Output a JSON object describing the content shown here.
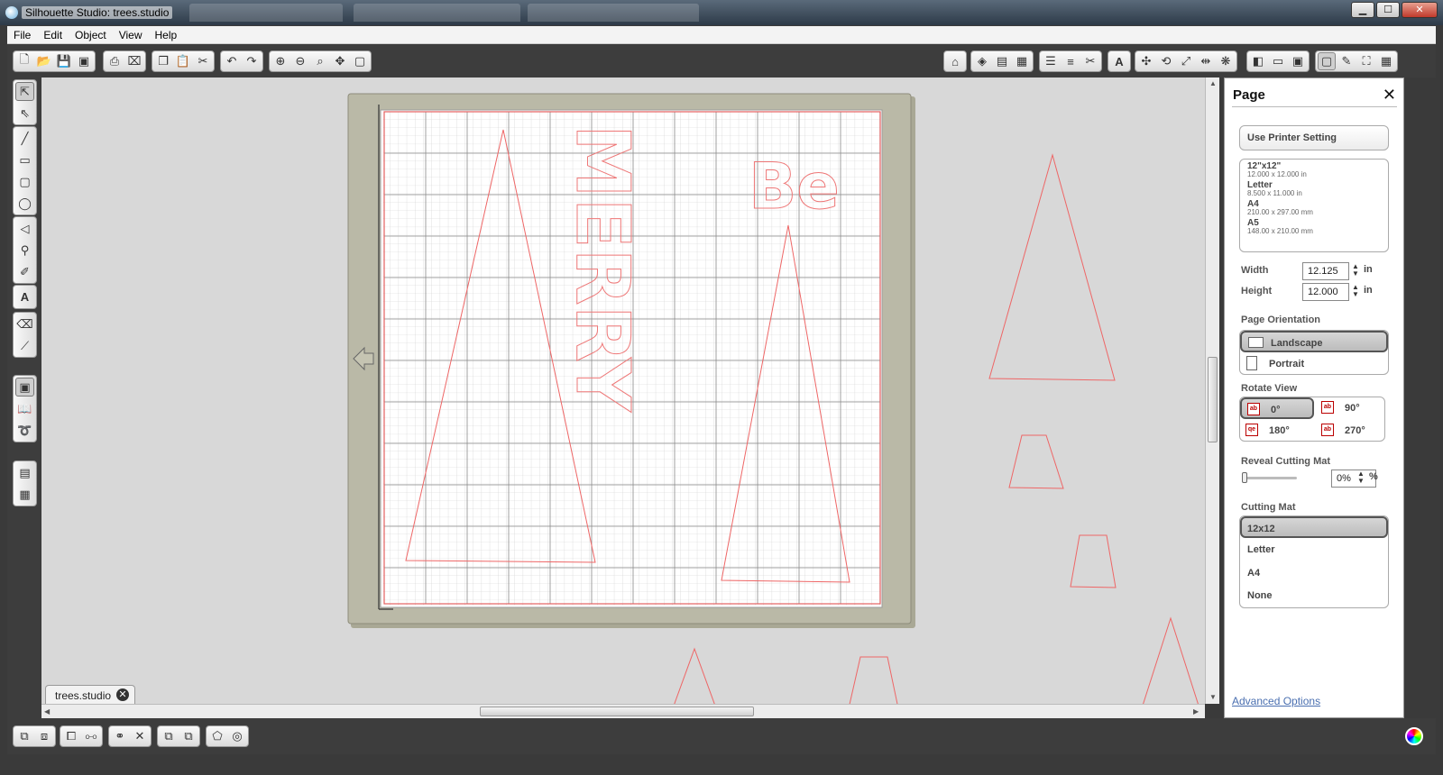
{
  "window": {
    "title": "Silhouette Studio: trees.studio",
    "controls": {
      "minimize": "▁",
      "maximize": "☐",
      "close": "✕"
    }
  },
  "menu": [
    "File",
    "Edit",
    "Object",
    "View",
    "Help"
  ],
  "canvas": {
    "text_merry": "MERRY",
    "text_be": "Be"
  },
  "doc_tab": {
    "label": "trees.studio",
    "close": "✕"
  },
  "panel": {
    "title": "Page",
    "close": "✕",
    "use_printer_setting": "Use Printer Setting",
    "sizes": [
      {
        "name": "12\"x12\"",
        "dims": "12.000 x 12.000 in"
      },
      {
        "name": "Letter",
        "dims": "8.500 x 11.000 in"
      },
      {
        "name": "A4",
        "dims": "210.00 x 297.00 mm"
      },
      {
        "name": "A5",
        "dims": "148.00 x 210.00 mm"
      }
    ],
    "width_label": "Width",
    "width_value": "12.125",
    "height_label": "Height",
    "height_value": "12.000",
    "unit": "in",
    "orientation_label": "Page Orientation",
    "orientation_landscape": "Landscape",
    "orientation_portrait": "Portrait",
    "rotate_label": "Rotate View",
    "rotate_0": "0°",
    "rotate_90": "90°",
    "rotate_180": "180°",
    "rotate_270": "270°",
    "reveal_label": "Reveal Cutting Mat",
    "reveal_value": "0%",
    "reveal_unit": "%",
    "reveal_level": 0,
    "cutting_mat_label": "Cutting Mat",
    "mats": [
      "12x12",
      "Letter",
      "A4",
      "None"
    ],
    "advanced": "Advanced Options"
  },
  "colors": {
    "cut_line": "#ee6666",
    "mat_gray": "#b9b8a6",
    "workspace": "#d8d8d8"
  }
}
